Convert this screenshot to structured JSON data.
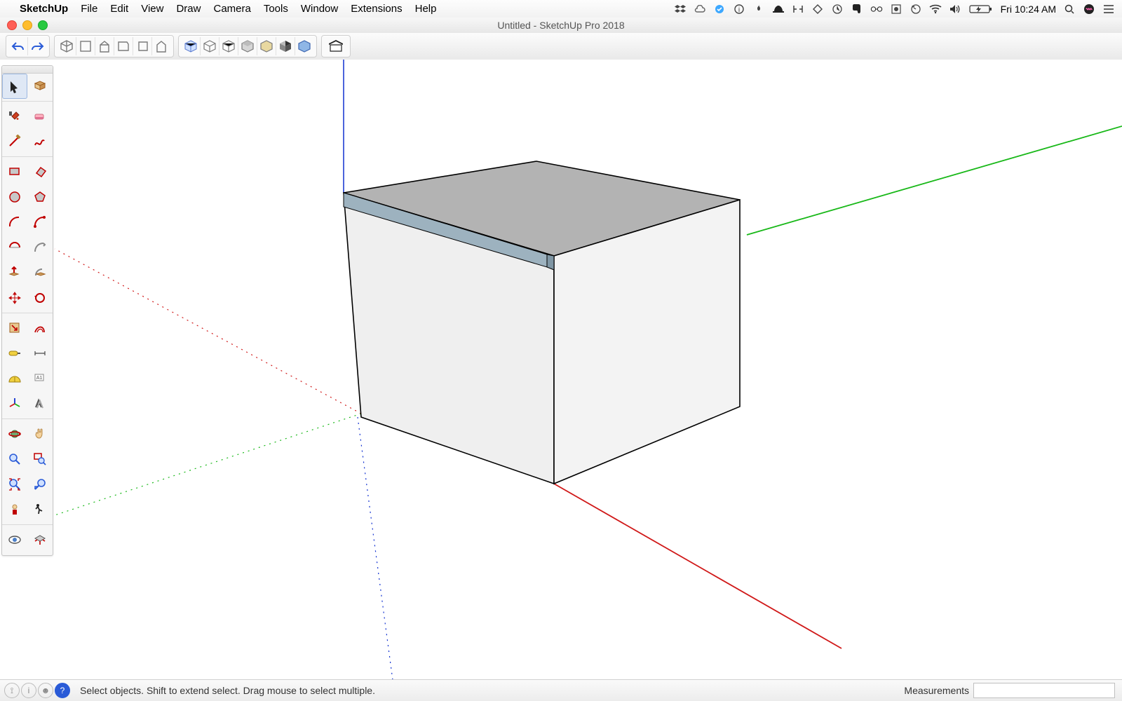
{
  "menubar": {
    "app_name": "SketchUp",
    "items": [
      "File",
      "Edit",
      "View",
      "Draw",
      "Camera",
      "Tools",
      "Window",
      "Extensions",
      "Help"
    ],
    "clock": "Fri 10:24 AM",
    "battery": "⚡"
  },
  "window": {
    "title": "Untitled - SketchUp Pro 2018"
  },
  "statusbar": {
    "hint": "Select objects. Shift to extend select. Drag mouse to select multiple.",
    "measurements_label": "Measurements"
  },
  "side_tools": {
    "groups": [
      [
        "select",
        "make-component"
      ],
      [
        "paint-bucket",
        "eraser"
      ],
      [
        "line",
        "freehand"
      ],
      [
        "rectangle",
        "rotated-rectangle"
      ],
      [
        "circle",
        "polygon"
      ],
      [
        "arc",
        "two-point-arc"
      ],
      [
        "three-point-arc",
        "pie"
      ],
      [
        "push-pull",
        "follow-me"
      ],
      [
        "move",
        "rotate"
      ],
      [
        "scale",
        "offset"
      ],
      [
        "tape-measure",
        "dimension"
      ],
      [
        "protractor",
        "text"
      ],
      [
        "axes",
        "3d-text"
      ],
      [
        "orbit",
        "pan"
      ],
      [
        "zoom",
        "zoom-window"
      ],
      [
        "zoom-extents",
        "previous"
      ],
      [
        "position-camera",
        "walk"
      ],
      [
        "look-around",
        "section-plane"
      ]
    ]
  }
}
